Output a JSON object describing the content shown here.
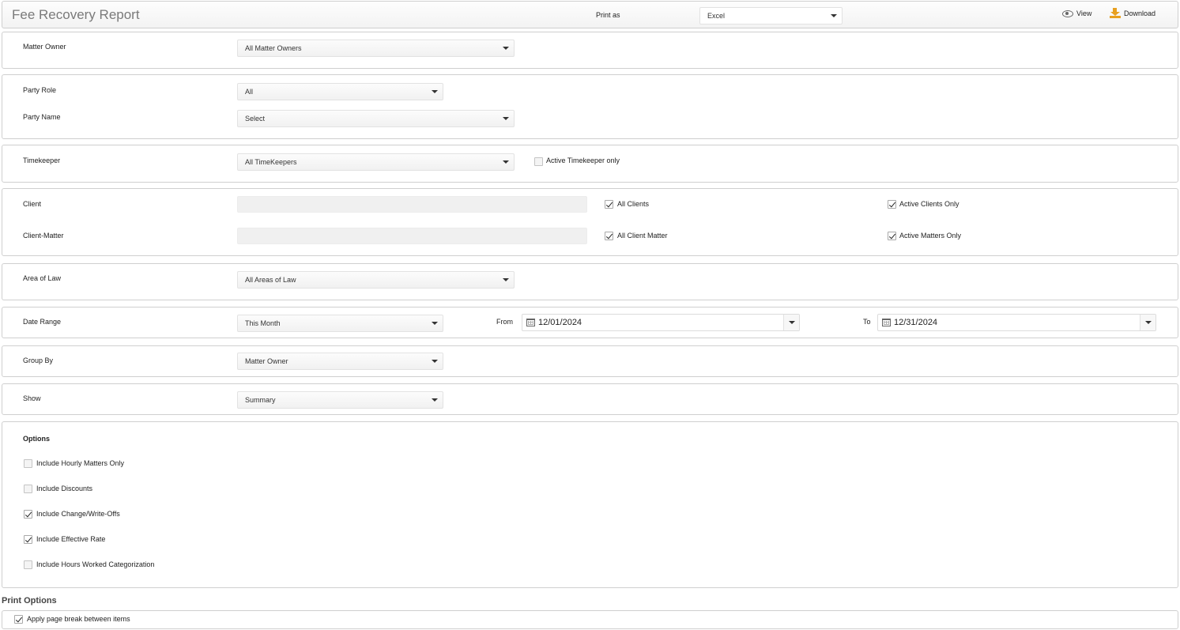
{
  "header": {
    "title": "Fee Recovery Report",
    "print_as_label": "Print as",
    "print_as_value": "Excel",
    "view_label": "View",
    "download_label": "Download"
  },
  "matter_owner": {
    "label": "Matter Owner",
    "value": "All Matter Owners"
  },
  "party": {
    "role_label": "Party Role",
    "role_value": "All",
    "name_label": "Party Name",
    "name_value": "Select"
  },
  "timekeeper": {
    "label": "Timekeeper",
    "value": "All TimeKeepers",
    "active_only_label": "Active Timekeeper only",
    "active_only_checked": false
  },
  "client": {
    "client_label": "Client",
    "all_clients_label": "All Clients",
    "all_clients_checked": true,
    "active_clients_label": "Active Clients Only",
    "active_clients_checked": true,
    "matter_label": "Client-Matter",
    "all_matter_label": "All Client Matter",
    "all_matter_checked": true,
    "active_matters_label": "Active Matters Only",
    "active_matters_checked": true
  },
  "area_of_law": {
    "label": "Area of Law",
    "value": "All Areas of Law"
  },
  "date_range": {
    "label": "Date Range",
    "value": "This Month",
    "from_label": "From",
    "from_value": "12/01/2024",
    "to_label": "To",
    "to_value": "12/31/2024"
  },
  "group_by": {
    "label": "Group By",
    "value": "Matter Owner"
  },
  "show": {
    "label": "Show",
    "value": "Summary"
  },
  "options": {
    "title": "Options",
    "items": [
      {
        "label": "Include Hourly Matters Only",
        "checked": false
      },
      {
        "label": "Include Discounts",
        "checked": false
      },
      {
        "label": "Include Change/Write-Offs",
        "checked": true
      },
      {
        "label": "Include Effective Rate",
        "checked": true
      },
      {
        "label": "Include Hours Worked Categorization",
        "checked": false
      }
    ]
  },
  "print_options": {
    "title": "Print Options",
    "page_break_label": "Apply page break between items",
    "page_break_checked": true
  }
}
